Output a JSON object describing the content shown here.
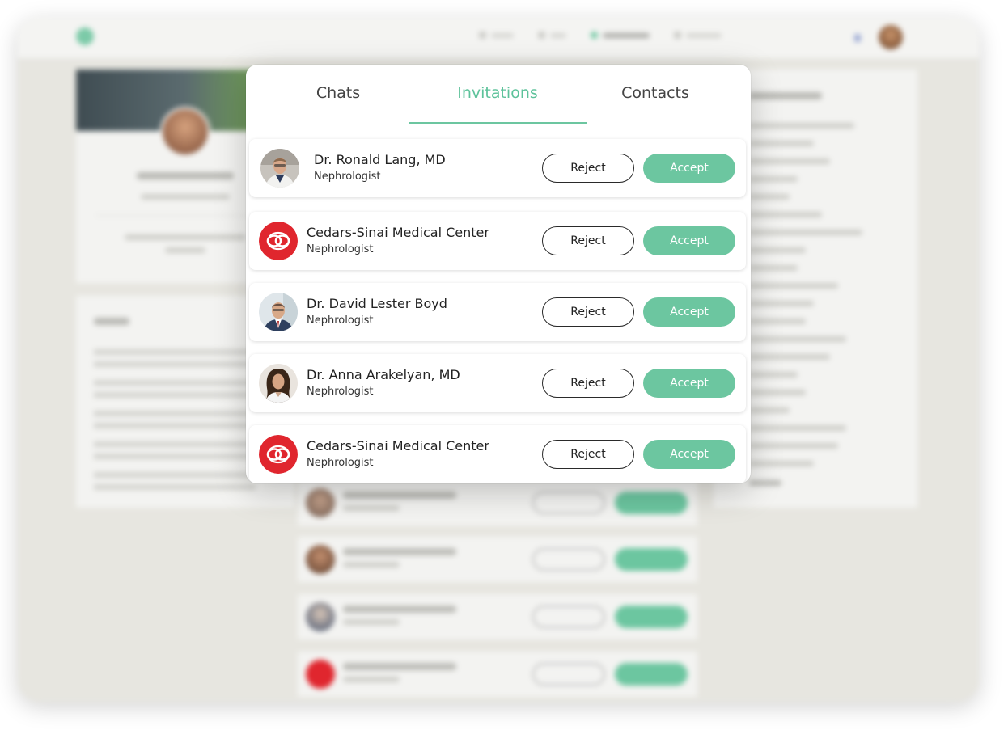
{
  "tabs": [
    {
      "label": "Chats",
      "active": false
    },
    {
      "label": "Invitations",
      "active": true
    },
    {
      "label": "Contacts",
      "active": false
    }
  ],
  "invitations": [
    {
      "name": "Dr. Ronald Lang, MD",
      "role": "Nephrologist",
      "avatar": "doctor-photo-ronald",
      "reject_label": "Reject",
      "accept_label": "Accept"
    },
    {
      "name": "Cedars-Sinai Medical Center",
      "role": "Nephrologist",
      "avatar": "cedars-sinai-logo",
      "reject_label": "Reject",
      "accept_label": "Accept"
    },
    {
      "name": "Dr. David Lester Boyd",
      "role": "Nephrologist",
      "avatar": "doctor-photo-david",
      "reject_label": "Reject",
      "accept_label": "Accept"
    },
    {
      "name": "Dr. Anna Arakelyan, MD",
      "role": "Nephrologist",
      "avatar": "doctor-photo-anna",
      "reject_label": "Reject",
      "accept_label": "Accept"
    },
    {
      "name": "Cedars-Sinai Medical Center",
      "role": "Nephrologist",
      "avatar": "cedars-sinai-logo",
      "reject_label": "Reject",
      "accept_label": "Accept"
    }
  ],
  "colors": {
    "accent": "#6cc6a0",
    "accent_text": "#5cc29a",
    "cedars_red": "#e0262e",
    "background_blur": "#e7e6e0"
  }
}
